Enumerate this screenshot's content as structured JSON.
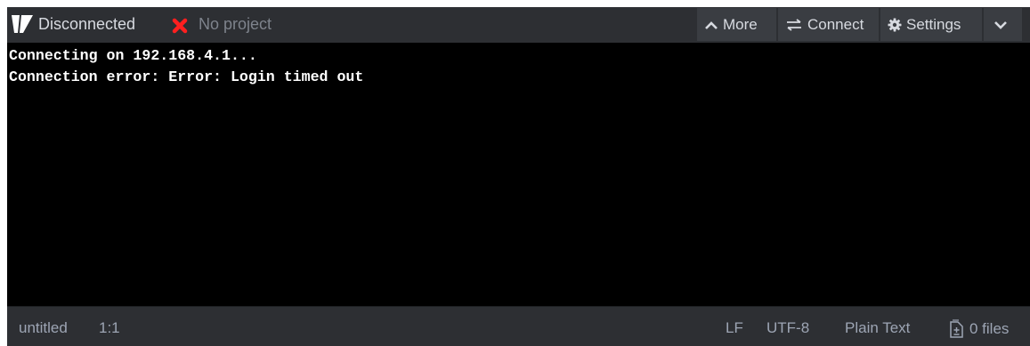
{
  "toolbar": {
    "status": "Disconnected",
    "project": "No project",
    "status_color": "#ff1f1f",
    "buttons": {
      "more": "More",
      "connect": "Connect",
      "settings": "Settings"
    },
    "icons": {
      "logo": "pymakr-logo-icon",
      "status": "close-x-icon",
      "more": "chevron-up-icon",
      "connect": "swap-arrows-icon",
      "settings": "gear-icon",
      "collapse": "chevron-down-icon"
    }
  },
  "console": {
    "lines": [
      "Connecting on 192.168.4.1...",
      "Connection error: Error: Login timed out"
    ]
  },
  "statusbar": {
    "file": "untitled",
    "cursor": "1:1",
    "line_ending": "LF",
    "encoding": "UTF-8",
    "grammar": "Plain Text",
    "files": "0 files"
  }
}
